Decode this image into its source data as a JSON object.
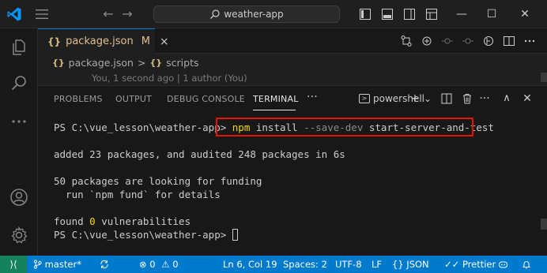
{
  "titlebar": {
    "search_text": "weather-app",
    "back_glyph": "←",
    "forward_glyph": "→",
    "minimize_glyph": "—",
    "maximize_glyph": "☐",
    "close_glyph": "✕"
  },
  "colors": {
    "accent": "#0078d4",
    "statusbar": "#007acc",
    "highlight_box": "#e51400",
    "command_yellow": "#f1d700"
  },
  "tab": {
    "braces": "{}",
    "name": "package.json",
    "modified": "M",
    "close": "×"
  },
  "breadcrumb": {
    "braces1": "{}",
    "file": "package.json",
    "sep": ">",
    "braces2": "{}",
    "section": "scripts"
  },
  "blame": "You, 1 second ago | 1 author (You)",
  "panel": {
    "tabs": [
      "PROBLEMS",
      "OUTPUT",
      "DEBUG CONSOLE",
      "TERMINAL"
    ],
    "more": "···",
    "shell": "powershell",
    "add": "+",
    "dropdown": "⌄",
    "chevron_up": "∧",
    "close": "✕"
  },
  "terminal": {
    "prompt1": "PS C:\\vue_lesson\\weather-app> ",
    "cmd_npm": "npm",
    "cmd_install": " install ",
    "cmd_flag": "--save-dev",
    "cmd_rest": " start-server-and-test",
    "out1": "added 23 packages, and audited 248 packages in 6s",
    "out2": "50 packages are looking for funding",
    "out3": "  run `npm fund` for details",
    "out4_pre": "found ",
    "out4_num": "0",
    "out4_post": " vulnerabilities",
    "prompt2": "PS C:\\vue_lesson\\weather-app> "
  },
  "statusbar": {
    "remote": "⟩⟨",
    "branch": "master*",
    "errors": "0",
    "warnings": "0",
    "position": "Ln 6, Col 19",
    "spaces": "Spaces: 2",
    "encoding": "UTF-8",
    "eol": "LF",
    "language_braces": "{}",
    "language": "JSON",
    "formatter": "Prettier"
  }
}
